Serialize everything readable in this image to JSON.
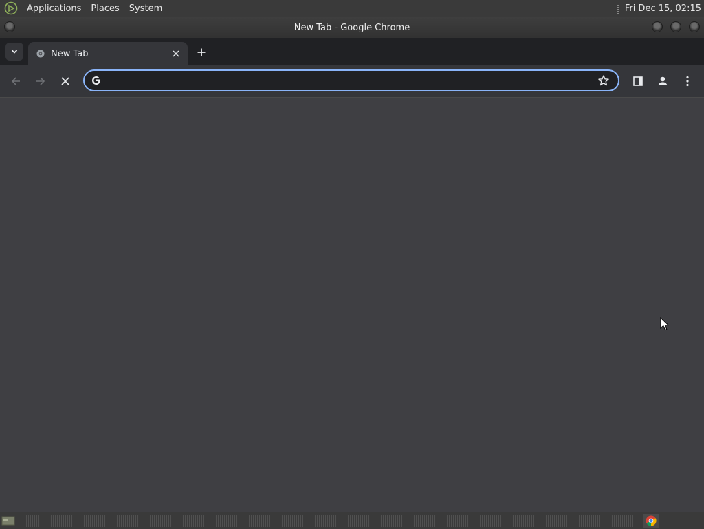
{
  "top_panel": {
    "menus": [
      "Applications",
      "Places",
      "System"
    ],
    "clock": "Fri Dec 15, 02:15"
  },
  "window": {
    "title": "New Tab - Google Chrome"
  },
  "tabs": [
    {
      "title": "New Tab",
      "active": true
    }
  ],
  "toolbar": {
    "omnibox_value": "",
    "omnibox_placeholder": ""
  },
  "icons": {
    "system_logo": "mate-logo-icon",
    "tab_search": "chevron-down-icon",
    "tab_favicon": "chrome-favicon-icon",
    "tab_close": "close-icon",
    "new_tab": "plus-icon",
    "back": "arrow-left-icon",
    "forward": "arrow-right-icon",
    "stop": "close-icon",
    "search_engine": "google-g-icon",
    "bookmark": "star-icon",
    "side_panel": "side-panel-icon",
    "profile": "profile-icon",
    "menu": "more-vert-icon",
    "taskbar_chrome": "chrome-icon"
  },
  "colors": {
    "accent_focus": "#8ab4f8",
    "tabstrip_bg": "#202124",
    "toolbar_bg": "#35363a",
    "content_bg": "#3f3f43"
  }
}
